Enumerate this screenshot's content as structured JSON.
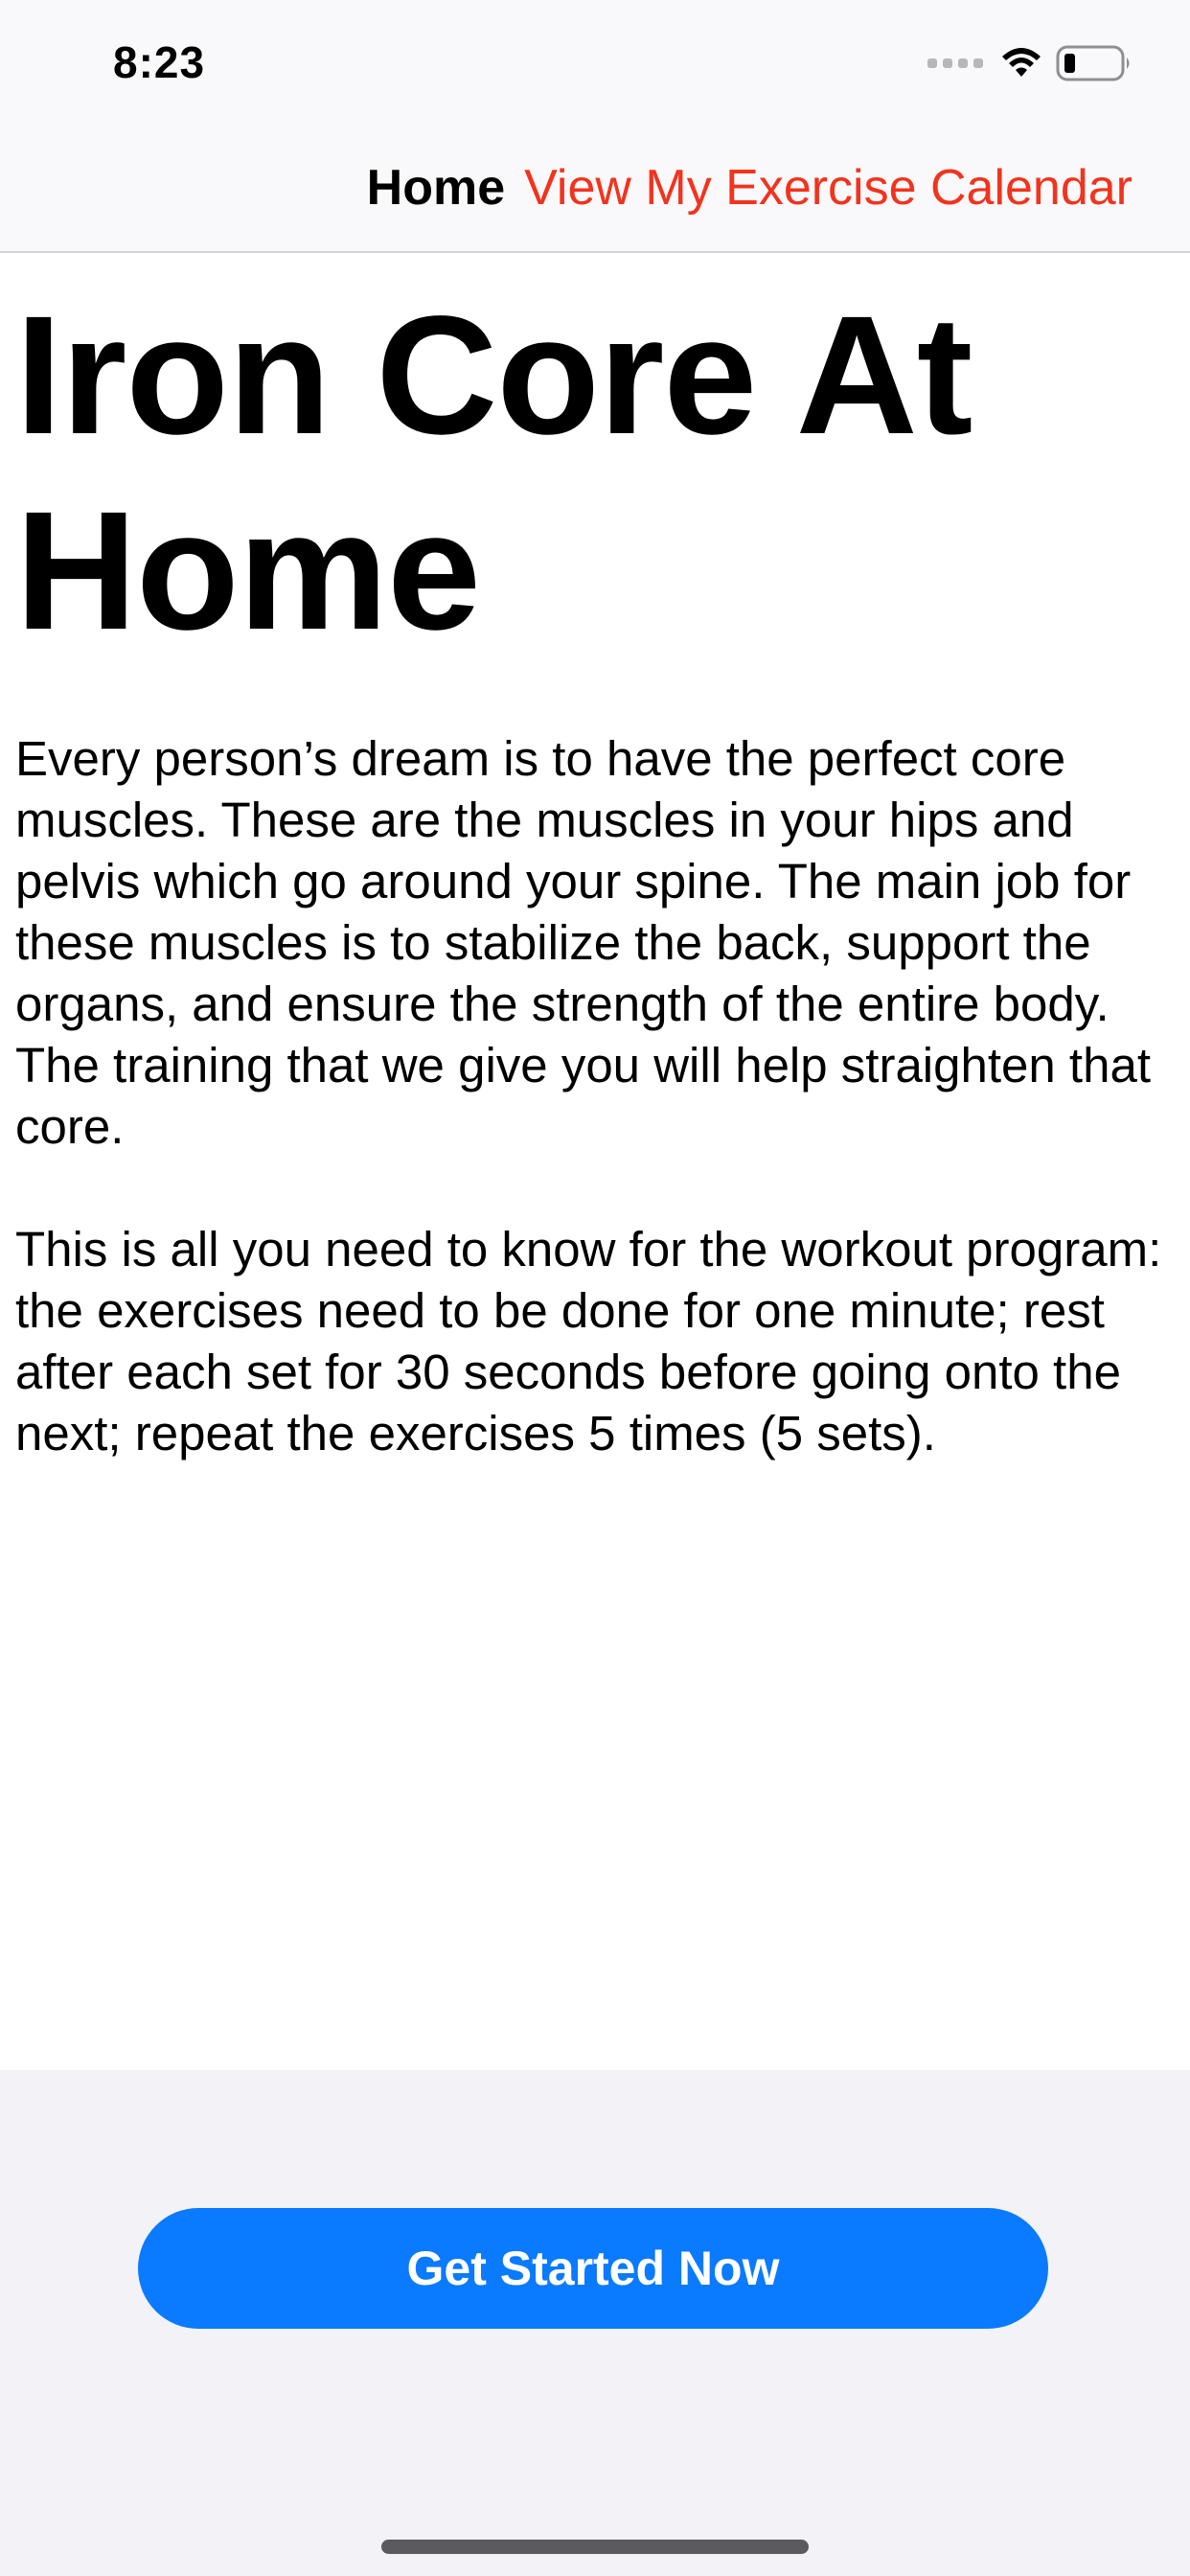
{
  "status_bar": {
    "time": "8:23",
    "icons": [
      "signal-dots-icon",
      "wifi-icon",
      "battery-icon"
    ]
  },
  "nav": {
    "home_label": "Home",
    "calendar_label": "View My Exercise Calendar"
  },
  "main": {
    "title": "Iron Core At Home",
    "paragraph_1": "Every person’s dream is to have the perfect core muscles. These are the muscles in your hips and pelvis which go around your spine. The main job for these muscles is to stabilize the back, support the organs, and ensure the strength of the entire body. The training that we give you will help straighten that core.",
    "paragraph_2": "This is all you need to know for the workout program: the exercises need to be done for one minute; rest after each set for 30 seconds before going onto the next; repeat the exercises 5 times (5 sets)."
  },
  "cta": {
    "label": "Get Started Now"
  },
  "colors": {
    "accent_link": "#f2331d",
    "primary_button": "#0a7aff",
    "top_bar_bg": "#f9f9fb",
    "bottom_bg": "#f2f2f7"
  }
}
